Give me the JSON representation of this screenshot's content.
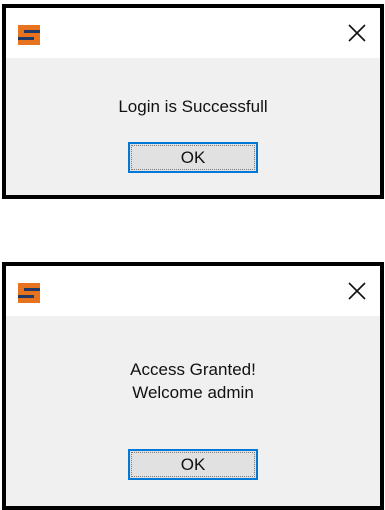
{
  "dialogs": [
    {
      "message_lines": [
        "Login is Successfull"
      ],
      "ok_label": "OK",
      "logo_icon": "app-s-logo-icon",
      "close_icon": "close-icon"
    },
    {
      "message_lines": [
        "Access Granted!",
        "Welcome admin"
      ],
      "ok_label": "OK",
      "logo_icon": "app-s-logo-icon",
      "close_icon": "close-icon"
    }
  ],
  "colors": {
    "logo_orange": "#e8731e",
    "logo_navy": "#1f3864",
    "button_focus_border": "#0078d7",
    "dialog_body": "#f0f0f0"
  }
}
